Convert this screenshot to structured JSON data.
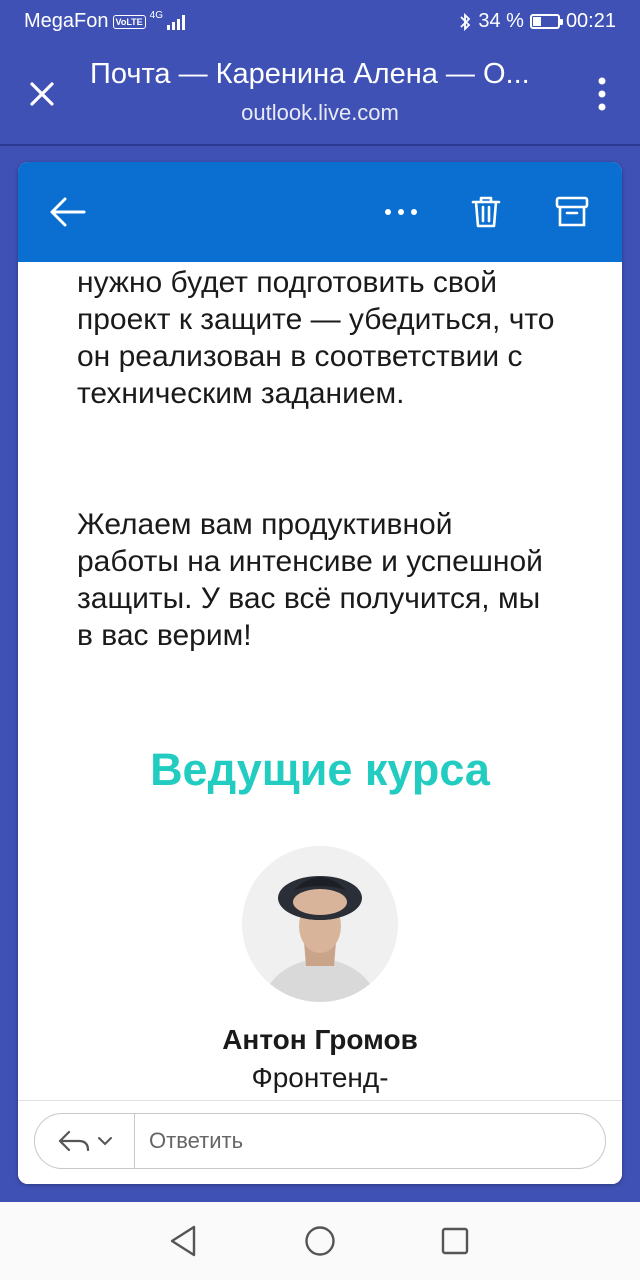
{
  "status_bar": {
    "carrier": "MegaFon",
    "volte": "VoLTE",
    "network": "4G",
    "battery": "34 %",
    "battery_level": 0.34,
    "time": "00:21"
  },
  "browser": {
    "title": "Почта — Каренина Алена — O...",
    "url": "outlook.live.com"
  },
  "email": {
    "paragraph_1": "нужно будет подготовить свой проект к защите — убедиться, что он реализован в соответствии с техническим заданием.",
    "paragraph_2": "Желаем вам продуктивной работы на интенсиве и успешной защиты. У вас всё получится, мы в вас верим!",
    "heading": "Ведущие курса",
    "presenter_name": "Антон Громов",
    "presenter_role": "Фронтенд-"
  },
  "reply": {
    "placeholder": "Ответить"
  },
  "colors": {
    "app_bar": "#3f51b5",
    "toolbar": "#0a6fd1",
    "heading": "#22ccc0"
  },
  "icons": {
    "close": "close-icon",
    "more": "more-vertical-icon",
    "back": "arrow-left-icon",
    "actions": "more-horizontal-icon",
    "delete": "trash-icon",
    "archive": "archive-icon",
    "reply": "reply-icon",
    "nav_back": "nav-back-icon",
    "nav_home": "nav-home-icon",
    "nav_recent": "nav-recent-icon"
  }
}
